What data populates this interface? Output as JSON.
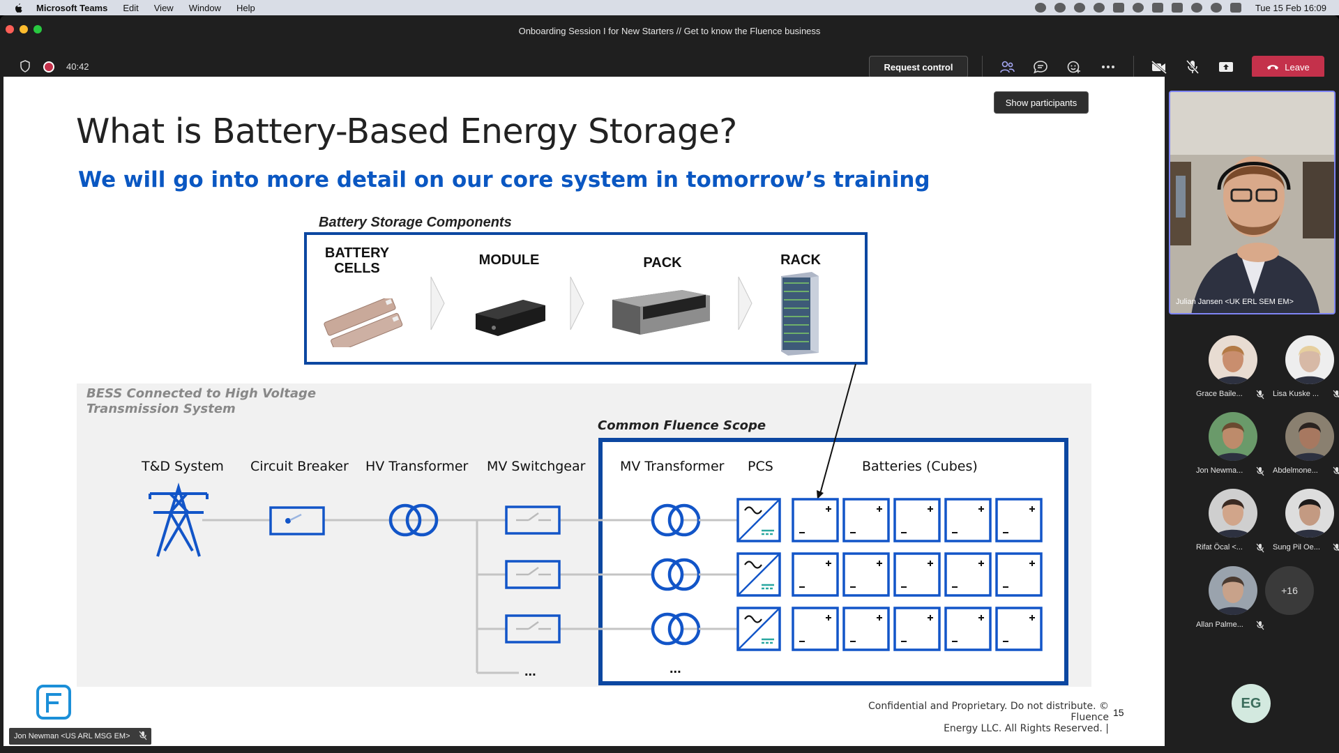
{
  "menubar": {
    "app_name": "Microsoft Teams",
    "items": [
      "Edit",
      "View",
      "Window",
      "Help"
    ],
    "clock": "Tue 15 Feb  16:09"
  },
  "window": {
    "title": "Onboarding Session I for New Starters // Get to know the Fluence business"
  },
  "callbar": {
    "timer": "40:42",
    "request_control": "Request control",
    "leave": "Leave",
    "tooltip": "Show participants"
  },
  "slide": {
    "title": "What is Battery-Based Energy Storage?",
    "subtitle": "We will go into more detail on our core system in tomorrow’s training",
    "components_caption": "Battery Storage Components",
    "components": [
      "BATTERY CELLS",
      "MODULE",
      "PACK",
      "RACK"
    ],
    "bess_caption_line1": "BESS Connected to High Voltage",
    "bess_caption_line2": "Transmission System",
    "scope_caption": "Common Fluence Scope",
    "columns": [
      "T&D System",
      "Circuit Breaker",
      "HV Transformer",
      "MV Switchgear",
      "MV Transformer",
      "PCS",
      "Batteries (Cubes)"
    ],
    "ellipsis": "...",
    "footer_line1": "Confidential and Proprietary. Do not distribute. © Fluence",
    "footer_line2": "Energy LLC. All Rights Reserved.  |",
    "page_number": "15",
    "brand_color": "#0c47a1",
    "accent_teal": "#2aa7a0"
  },
  "presenter": {
    "name": "Jon Newman <US ARL MSG EM>"
  },
  "video": {
    "name": "Julian Jansen <UK ERL SEM EM>"
  },
  "participants": [
    {
      "name": "Grace Baile...",
      "muted": true
    },
    {
      "name": "Lisa Kuske ...",
      "muted": true
    },
    {
      "name": "Jon Newma...",
      "muted": true
    },
    {
      "name": "Abdelmone...",
      "muted": true
    },
    {
      "name": "Rifat Öcal <...",
      "muted": true
    },
    {
      "name": "Sung Pil Oe...",
      "muted": true
    },
    {
      "name": "Allan Palme...",
      "muted": true
    }
  ],
  "more_participants": "+16",
  "self": {
    "initials": "EG"
  }
}
